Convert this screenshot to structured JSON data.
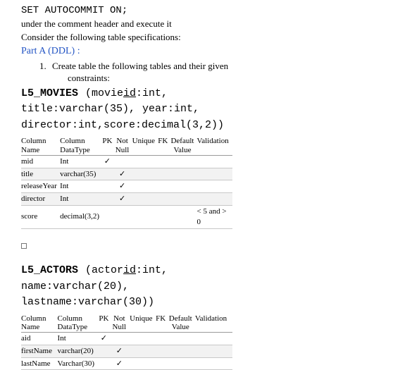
{
  "sql_line": "SET AUTOCOMMIT ON;",
  "intro": {
    "l1": "under the comment header and execute it",
    "l2": "Consider the following table specifications:"
  },
  "part_a": "Part A (DDL) :",
  "step1_num": "1.",
  "step1_text": "Create table the following tables and their given",
  "step1_cont": "constraints:",
  "movies": {
    "sig_l1_name": "L5_MOVIES",
    "sig_l1_rest_a": "  (movie",
    "sig_l1_rest_b": "id",
    "sig_l1_rest_c": ":int,",
    "sig_l2": "title:varchar(35), year:int,",
    "sig_l3": "director:int,score:decimal(3,2))",
    "headers": {
      "name_l1": "Column",
      "name_l2": "Name",
      "type_l1": "Column",
      "type_l2": "DataType",
      "pk": "PK",
      "nn_l1": "Not",
      "nn_l2": "Null",
      "uq": "Unique",
      "fk": "FK",
      "df_l1": "Default",
      "df_l2": "Value",
      "vv": "Validation"
    },
    "rows": [
      {
        "name": "mid",
        "type": "Int",
        "pk": "✓",
        "nn": "",
        "uq": "",
        "fk": "",
        "df": "",
        "vv": ""
      },
      {
        "name": "title",
        "type": "varchar(35)",
        "pk": "",
        "nn": "✓",
        "uq": "",
        "fk": "",
        "df": "",
        "vv": ""
      },
      {
        "name": "releaseYear",
        "type": "Int",
        "pk": "",
        "nn": "✓",
        "uq": "",
        "fk": "",
        "df": "",
        "vv": ""
      },
      {
        "name": "director",
        "type": "Int",
        "pk": "",
        "nn": "✓",
        "uq": "",
        "fk": "",
        "df": "",
        "vv": ""
      },
      {
        "name": "score",
        "type": "decimal(3,2)",
        "pk": "",
        "nn": "",
        "uq": "",
        "fk": "",
        "df": "",
        "vv": "< 5 and > 0"
      }
    ]
  },
  "actors": {
    "sig_l1_name": "L5_ACTORS",
    "sig_l1_rest_a": "  (actor",
    "sig_l1_rest_b": "id",
    "sig_l1_rest_c": ":int,",
    "sig_l2": "name:varchar(20),",
    "sig_l3": "lastname:varchar(30))",
    "headers": {
      "name_l1": "Column",
      "name_l2": "Name",
      "type_l1": "Column",
      "type_l2": "DataType",
      "pk": "PK",
      "nn_l1": "Not",
      "nn_l2": "Null",
      "uq": "Unique",
      "fk": "FK",
      "df_l1": "Default",
      "df_l2": "Value",
      "vv": "Validation"
    },
    "rows": [
      {
        "name": "aid",
        "type": "Int",
        "pk": "✓",
        "nn": "",
        "uq": "",
        "fk": "",
        "df": "",
        "vv": ""
      },
      {
        "name": "firstName",
        "type": "varchar(20)",
        "pk": "",
        "nn": "✓",
        "uq": "",
        "fk": "",
        "df": "",
        "vv": ""
      },
      {
        "name": "lastName",
        "type": "Varchar(30)",
        "pk": "",
        "nn": "✓",
        "uq": "",
        "fk": "",
        "df": "",
        "vv": ""
      }
    ]
  }
}
